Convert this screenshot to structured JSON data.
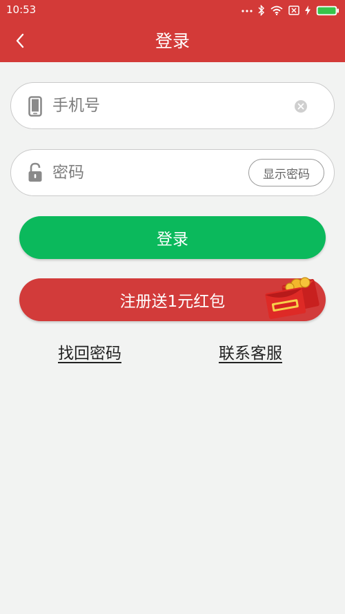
{
  "status_bar": {
    "time": "10:53"
  },
  "header": {
    "title": "登录",
    "back_icon": "chevron-left-icon"
  },
  "phone_field": {
    "placeholder": "手机号",
    "value": "",
    "icon": "smartphone-icon",
    "clear_icon": "clear-icon"
  },
  "password_field": {
    "placeholder": "密码",
    "value": "",
    "icon": "lock-icon",
    "show_password_label": "显示密码"
  },
  "login_button": {
    "label": "登录"
  },
  "register_button": {
    "label": "注册送1元红包",
    "badge_icon": "red-packet-icon"
  },
  "links": {
    "forgot_password": "找回密码",
    "contact_service": "联系客服"
  },
  "colors": {
    "header_bg": "#d33a38",
    "login_green": "#0bb95c",
    "register_red": "#d23b3a",
    "page_bg": "#f2f3f2"
  }
}
